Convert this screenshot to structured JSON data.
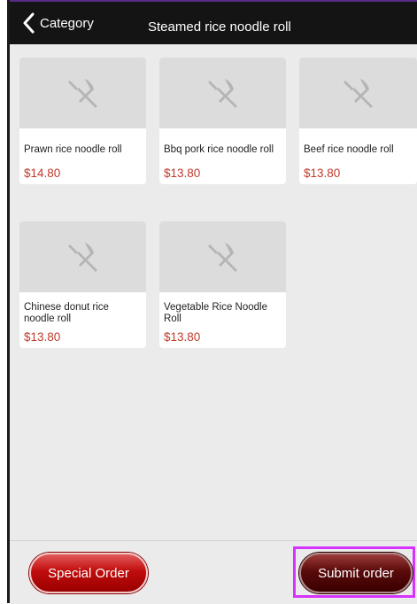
{
  "header": {
    "back_label": "Category",
    "title": "Steamed rice noodle roll"
  },
  "items": [
    {
      "name": "Prawn rice noodle roll",
      "price": "$14.80",
      "icon": "fork-knife-icon"
    },
    {
      "name": "Bbq pork rice noodle roll",
      "price": "$13.80",
      "icon": "fork-knife-icon"
    },
    {
      "name": "Beef rice noodle roll",
      "price": "$13.80",
      "icon": "fork-knife-icon"
    },
    {
      "name": "Chinese donut rice noodle roll",
      "price": "$13.80",
      "icon": "fork-knife-icon"
    },
    {
      "name": "Vegetable Rice Noodle Roll",
      "price": "$13.80",
      "icon": "fork-knife-icon"
    }
  ],
  "footer": {
    "special_order_label": "Special Order",
    "submit_order_label": "Submit order"
  },
  "colors": {
    "header_bg": "#141414",
    "price": "#c0392b",
    "special_button": "#c00c0c",
    "submit_button": "#5a0a0a",
    "highlight": "#d633ff"
  }
}
